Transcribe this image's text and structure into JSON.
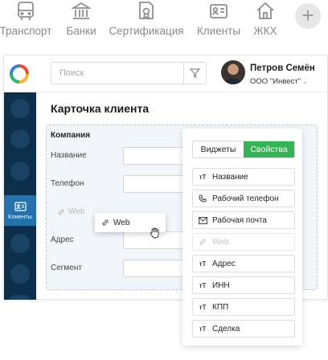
{
  "categories": [
    {
      "label": "Транспорт",
      "icon": "bus-icon"
    },
    {
      "label": "Банки",
      "icon": "bank-icon"
    },
    {
      "label": "Сертификация",
      "icon": "certificate-icon"
    },
    {
      "label": "Клиенты",
      "icon": "contact-card-icon"
    },
    {
      "label": "ЖКХ",
      "icon": "house-icon"
    }
  ],
  "add_button": {
    "label": "+",
    "icon": "plus-icon"
  },
  "search": {
    "placeholder": "Поиск"
  },
  "user": {
    "name": "Петров Семён",
    "org": "ООО \"Инвест\"",
    "caret": "⌄"
  },
  "sidebar": {
    "active_label": "Клиенты"
  },
  "page": {
    "title": "Карточка клиента",
    "section": "Компания",
    "fields": [
      {
        "label": "Название"
      },
      {
        "label": "Телефон"
      },
      {
        "label": "Адрес"
      },
      {
        "label": "Сегмент"
      }
    ],
    "ghost_field": "Web"
  },
  "drag_item": {
    "label": "Web"
  },
  "panel": {
    "tabs": [
      {
        "label": "Виджеты",
        "active": false
      },
      {
        "label": "Свойства",
        "active": true
      }
    ],
    "items": [
      {
        "label": "Название",
        "icon": "text-icon",
        "dim": false
      },
      {
        "label": "Рабочий телефон",
        "icon": "phone-icon",
        "dim": false
      },
      {
        "label": "Рабочая почта",
        "icon": "mail-icon",
        "dim": false
      },
      {
        "label": "Web",
        "icon": "link-icon",
        "dim": true
      },
      {
        "label": "Адрес",
        "icon": "text-icon",
        "dim": false
      },
      {
        "label": "ИНН",
        "icon": "text-icon",
        "dim": false
      },
      {
        "label": "КПП",
        "icon": "text-icon",
        "dim": false
      },
      {
        "label": "Сделка",
        "icon": "text-icon",
        "dim": false
      }
    ]
  },
  "colors": {
    "accent": "#33b555",
    "sidebar": "#0c2f4b",
    "sidebar_active": "#2472ab"
  }
}
